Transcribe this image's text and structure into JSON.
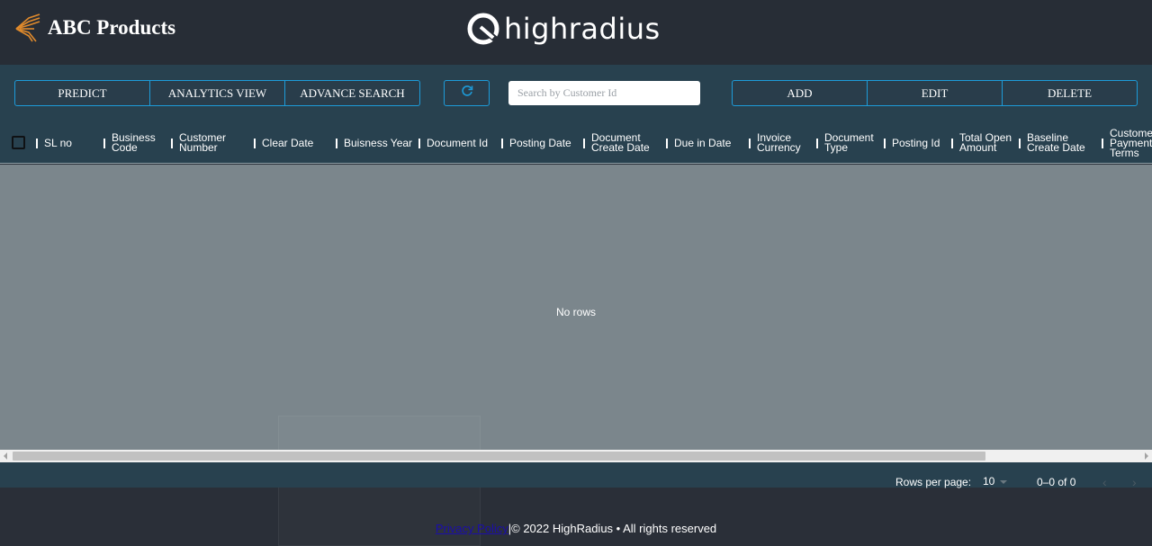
{
  "header": {
    "brand_name": "ABC Products",
    "company_logo_text": "highradius"
  },
  "toolbar": {
    "left_buttons": [
      "PREDICT",
      "ANALYTICS VIEW",
      "ADVANCE SEARCH"
    ],
    "search_placeholder": "Search by Customer Id",
    "right_buttons": [
      "ADD",
      "EDIT",
      "DELETE"
    ],
    "accent_color": "#1d9bd9"
  },
  "table": {
    "columns": [
      "SL no",
      "Business\nCode",
      "Customer\nNumber",
      "Clear Date",
      "Buisness Year",
      "Document Id",
      "Posting Date",
      "Document\nCreate Date",
      "Due in Date",
      "Invoice\nCurrency",
      "Document\nType",
      "Posting Id",
      "Total Open\nAmount",
      "Baseline\nCreate Date",
      "Customer\nPayment\nTerms"
    ],
    "empty_message": "No rows"
  },
  "pagination": {
    "rows_per_page_label": "Rows per page:",
    "rows_per_page_value": "10",
    "range": "0–0 of 0",
    "prev_icon": "‹",
    "next_icon": "›"
  },
  "footer": {
    "privacy_link": "Privacy Policy",
    "copyright": "|© 2022 HighRadius • All rights reserved"
  }
}
